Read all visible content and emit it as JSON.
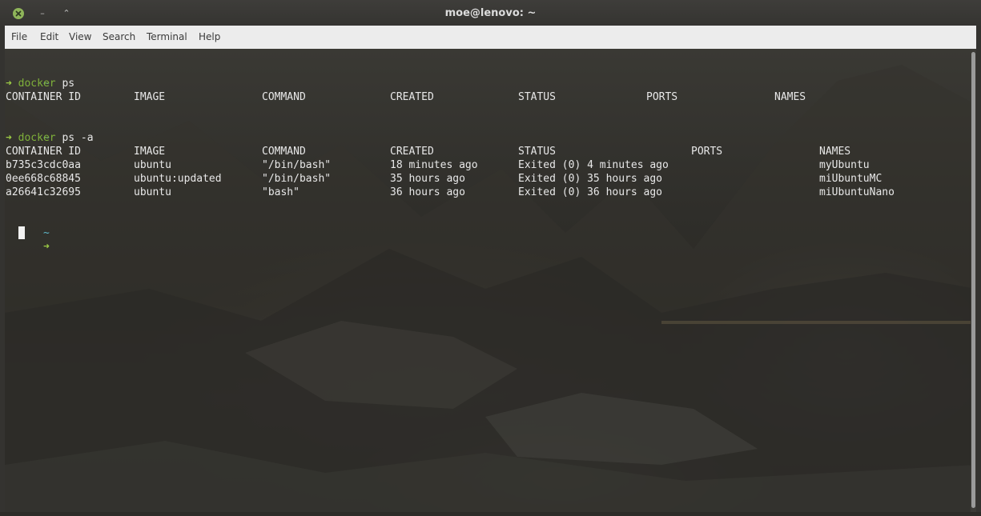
{
  "window": {
    "title": "moe@lenovo: ~",
    "close_icon": "close-icon",
    "minimize_glyph": "–",
    "maximize_glyph": "⌃"
  },
  "menu": [
    "File",
    "Edit",
    "View",
    "Search",
    "Terminal",
    "Help"
  ],
  "terminal": {
    "prompt_dir": "~",
    "prompt_arrow": "➜",
    "session1": {
      "cmd": "docker",
      "args": " ps",
      "headers": [
        "CONTAINER ID",
        "IMAGE",
        "COMMAND",
        "CREATED",
        "STATUS",
        "PORTS",
        "NAMES"
      ]
    },
    "session2": {
      "cmd": "docker",
      "args": " ps -a",
      "headers": [
        "CONTAINER ID",
        "IMAGE",
        "COMMAND",
        "CREATED",
        "STATUS",
        "PORTS",
        "NAMES"
      ],
      "rows": [
        [
          "b735c3cdc0aa",
          "ubuntu",
          "\"/bin/bash\"",
          "18 minutes ago",
          "Exited (0) 4 minutes ago",
          "",
          "myUbuntu"
        ],
        [
          "0ee668c68845",
          "ubuntu:updated",
          "\"/bin/bash\"",
          "35 hours ago",
          "Exited (0) 35 hours ago",
          "",
          "miUbuntuMC"
        ],
        [
          "a26641c32695",
          "ubuntu",
          "\"bash\"",
          "36 hours ago",
          "Exited (0) 36 hours ago",
          "",
          "miUbuntuNano"
        ]
      ]
    }
  },
  "colors": {
    "tilde": "#5fb8c9",
    "arrow": "#9ccc45",
    "command": "#7fb13a",
    "text": "#e8e8e8"
  }
}
